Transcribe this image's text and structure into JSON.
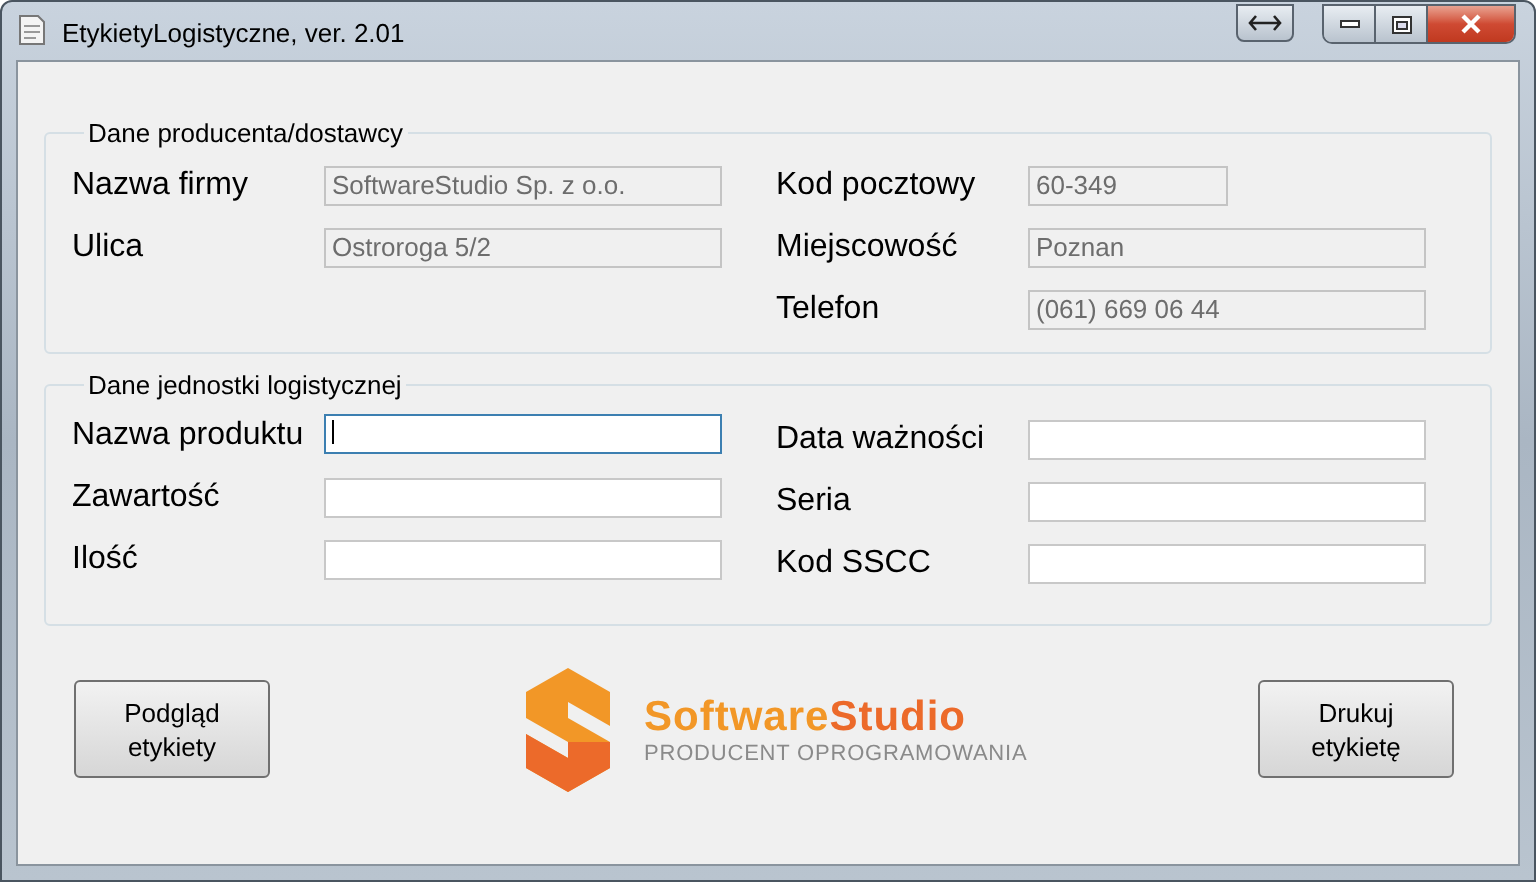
{
  "window": {
    "title": "EtykietyLogistyczne, ver. 2.01"
  },
  "groups": [
    {
      "title": "Dane producenta/dostawcy",
      "left": [
        {
          "label": "Nazwa firmy",
          "value": "SoftwareStudio Sp. z o.o.",
          "disabled": true,
          "focused": false,
          "kind": "wide"
        },
        {
          "label": "Ulica",
          "value": "Ostroroga 5/2",
          "disabled": true,
          "focused": false,
          "kind": "wide"
        }
      ],
      "right": [
        {
          "label": "Kod pocztowy",
          "value": "60-349",
          "disabled": true,
          "focused": false,
          "kind": "short"
        },
        {
          "label": "Miejscowość",
          "value": "Poznan",
          "disabled": true,
          "focused": false,
          "kind": "wide"
        },
        {
          "label": "Telefon",
          "value": "(061) 669 06 44",
          "disabled": true,
          "focused": false,
          "kind": "wide"
        }
      ]
    },
    {
      "title": "Dane jednostki logistycznej",
      "left": [
        {
          "label": "Nazwa produktu",
          "disabled": false,
          "focused": true,
          "kind": "wide"
        },
        {
          "label": "Zawartość",
          "disabled": false,
          "focused": false,
          "kind": "wide"
        },
        {
          "label": "Ilość",
          "disabled": false,
          "focused": false,
          "kind": "wide"
        }
      ],
      "right": [
        {
          "label": "Data ważności",
          "disabled": false,
          "focused": false,
          "kind": "wide"
        },
        {
          "label": "Seria",
          "disabled": false,
          "focused": false,
          "kind": "wide"
        },
        {
          "label": "Kod SSCC",
          "disabled": false,
          "focused": false,
          "kind": "wide"
        }
      ]
    }
  ],
  "buttons": [
    {
      "lines": [
        "Podgląd",
        "etykiety"
      ]
    },
    {
      "lines": [
        "Drukuj",
        "etykietę"
      ]
    }
  ],
  "logo": {
    "wordmark": [
      "Software",
      "Studio"
    ],
    "tagline": "PRODUCENT OPROGRAMOWANIA"
  }
}
